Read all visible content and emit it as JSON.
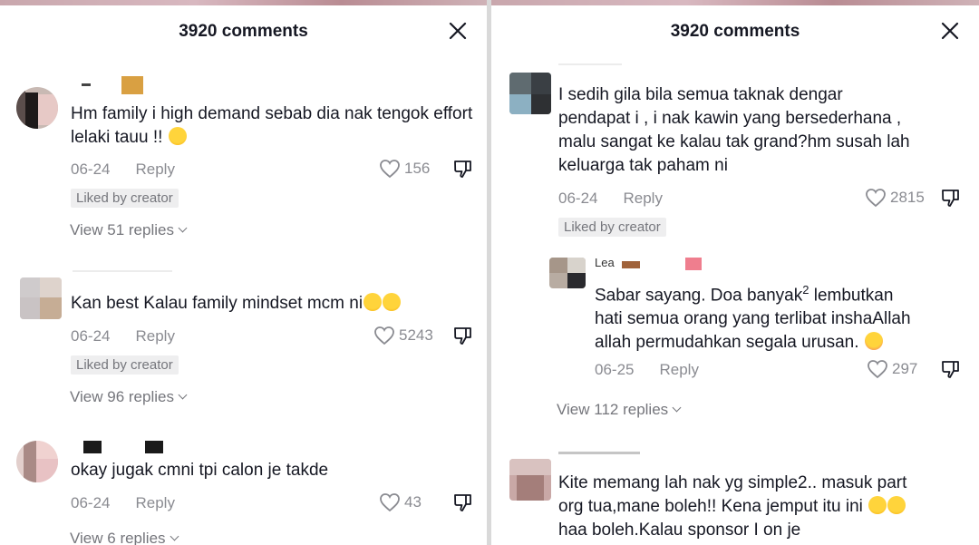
{
  "left": {
    "title": "3920 comments",
    "comments": [
      {
        "text": "Hm family i high demand sebab dia nak tengok effort lelaki tauu !!",
        "date": "06-24",
        "reply": "Reply",
        "likes": "156",
        "badge": "Liked by creator",
        "view_replies": "View 51 replies"
      },
      {
        "text": "Kan best Kalau family mindset mcm ni",
        "date": "06-24",
        "reply": "Reply",
        "likes": "5243",
        "badge": "Liked by creator",
        "view_replies": "View 96 replies"
      },
      {
        "text": "okay jugak cmni tpi calon je takde",
        "date": "06-24",
        "reply": "Reply",
        "likes": "43",
        "view_replies": "View 6 replies"
      }
    ]
  },
  "right": {
    "title": "3920 comments",
    "comments": [
      {
        "text_lines": [
          "I sedih gila bila semua taknak dengar",
          "pendapat i , i nak kawin yang bersederhana ,",
          "malu sangat ke kalau tak grand?hm susah lah",
          "keluarga tak paham ni"
        ],
        "date": "06-24",
        "reply": "Reply",
        "likes": "2815",
        "badge": "Liked by creator"
      },
      {
        "name": "Lea",
        "text_lines": [
          "Sabar sayang. Doa banyak",
          "hati semua orang yang terlibat inshaAllah",
          "allah permudahkan segala urusan."
        ],
        "superscript": "2",
        "after_sup": " lembutkan",
        "date": "06-25",
        "reply": "Reply",
        "likes": "297"
      },
      {
        "view_replies": "View 112 replies"
      },
      {
        "text_lines": [
          "Kite memang lah nak yg simple2.. masuk part",
          "org tua,mane boleh!! Kena jemput itu ini",
          "haa boleh.Kalau sponsor I on je"
        ]
      }
    ]
  },
  "icons": {
    "heart": "heart-outline-icon",
    "dislike": "thumbs-down-icon",
    "close": "close-icon",
    "chevron": "chevron-down-icon"
  },
  "colors": {
    "text": "#161823",
    "muted": "#8a8b91",
    "badge_bg": "#eeeeef"
  }
}
